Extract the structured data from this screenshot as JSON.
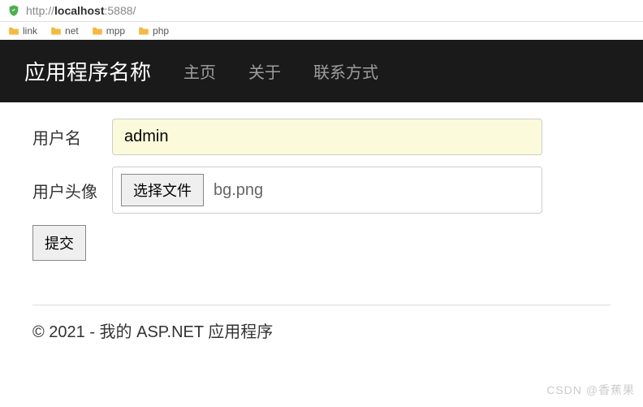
{
  "browser": {
    "url_prefix": "http://",
    "url_host": "localhost",
    "url_port_path": ":5888/"
  },
  "bookmarks": [
    {
      "label": "link"
    },
    {
      "label": "net"
    },
    {
      "label": "mpp"
    },
    {
      "label": "php"
    }
  ],
  "navbar": {
    "brand": "应用程序名称",
    "links": [
      {
        "label": "主页"
      },
      {
        "label": "关于"
      },
      {
        "label": "联系方式"
      }
    ]
  },
  "form": {
    "username_label": "用户名",
    "username_value": "admin",
    "avatar_label": "用户头像",
    "file_button": "选择文件",
    "file_name": "bg.png",
    "submit_label": "提交"
  },
  "footer": {
    "text": "© 2021 - 我的 ASP.NET 应用程序"
  },
  "watermark": "CSDN @香蕉果"
}
